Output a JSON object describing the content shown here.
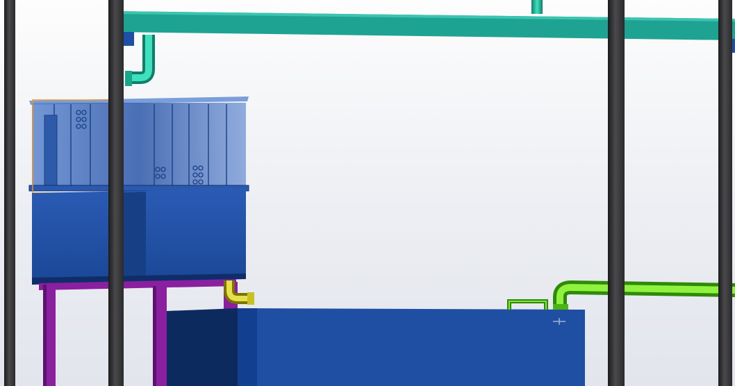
{
  "viewport": {
    "background_top": "#fdfdfd",
    "background_bottom": "#e2e5ec"
  },
  "colors": {
    "frame_column": "#3a3a3c",
    "frame_column_light": "#6b6b6e",
    "teal_beam": "#1ea392",
    "teal_beam_dark": "#137a6c",
    "tank_blue": "#1f4fa3",
    "tank_blue_dark": "#112c63",
    "glass_blue": "#3d6cc0",
    "stand_purple": "#8a1fa0",
    "pipe_teal": "#1fb89a",
    "pipe_olive": "#b7b21c",
    "pipe_green": "#5fd81a",
    "selection_orange": "#e8952a"
  },
  "components": {
    "overhead_beam": "overhead-beam",
    "upper_tank": "upper-tank",
    "lower_tank": "lower-tank",
    "stand": "tank-stand",
    "pipes": [
      "teal-pipe",
      "olive-pipe",
      "green-pipe"
    ]
  }
}
